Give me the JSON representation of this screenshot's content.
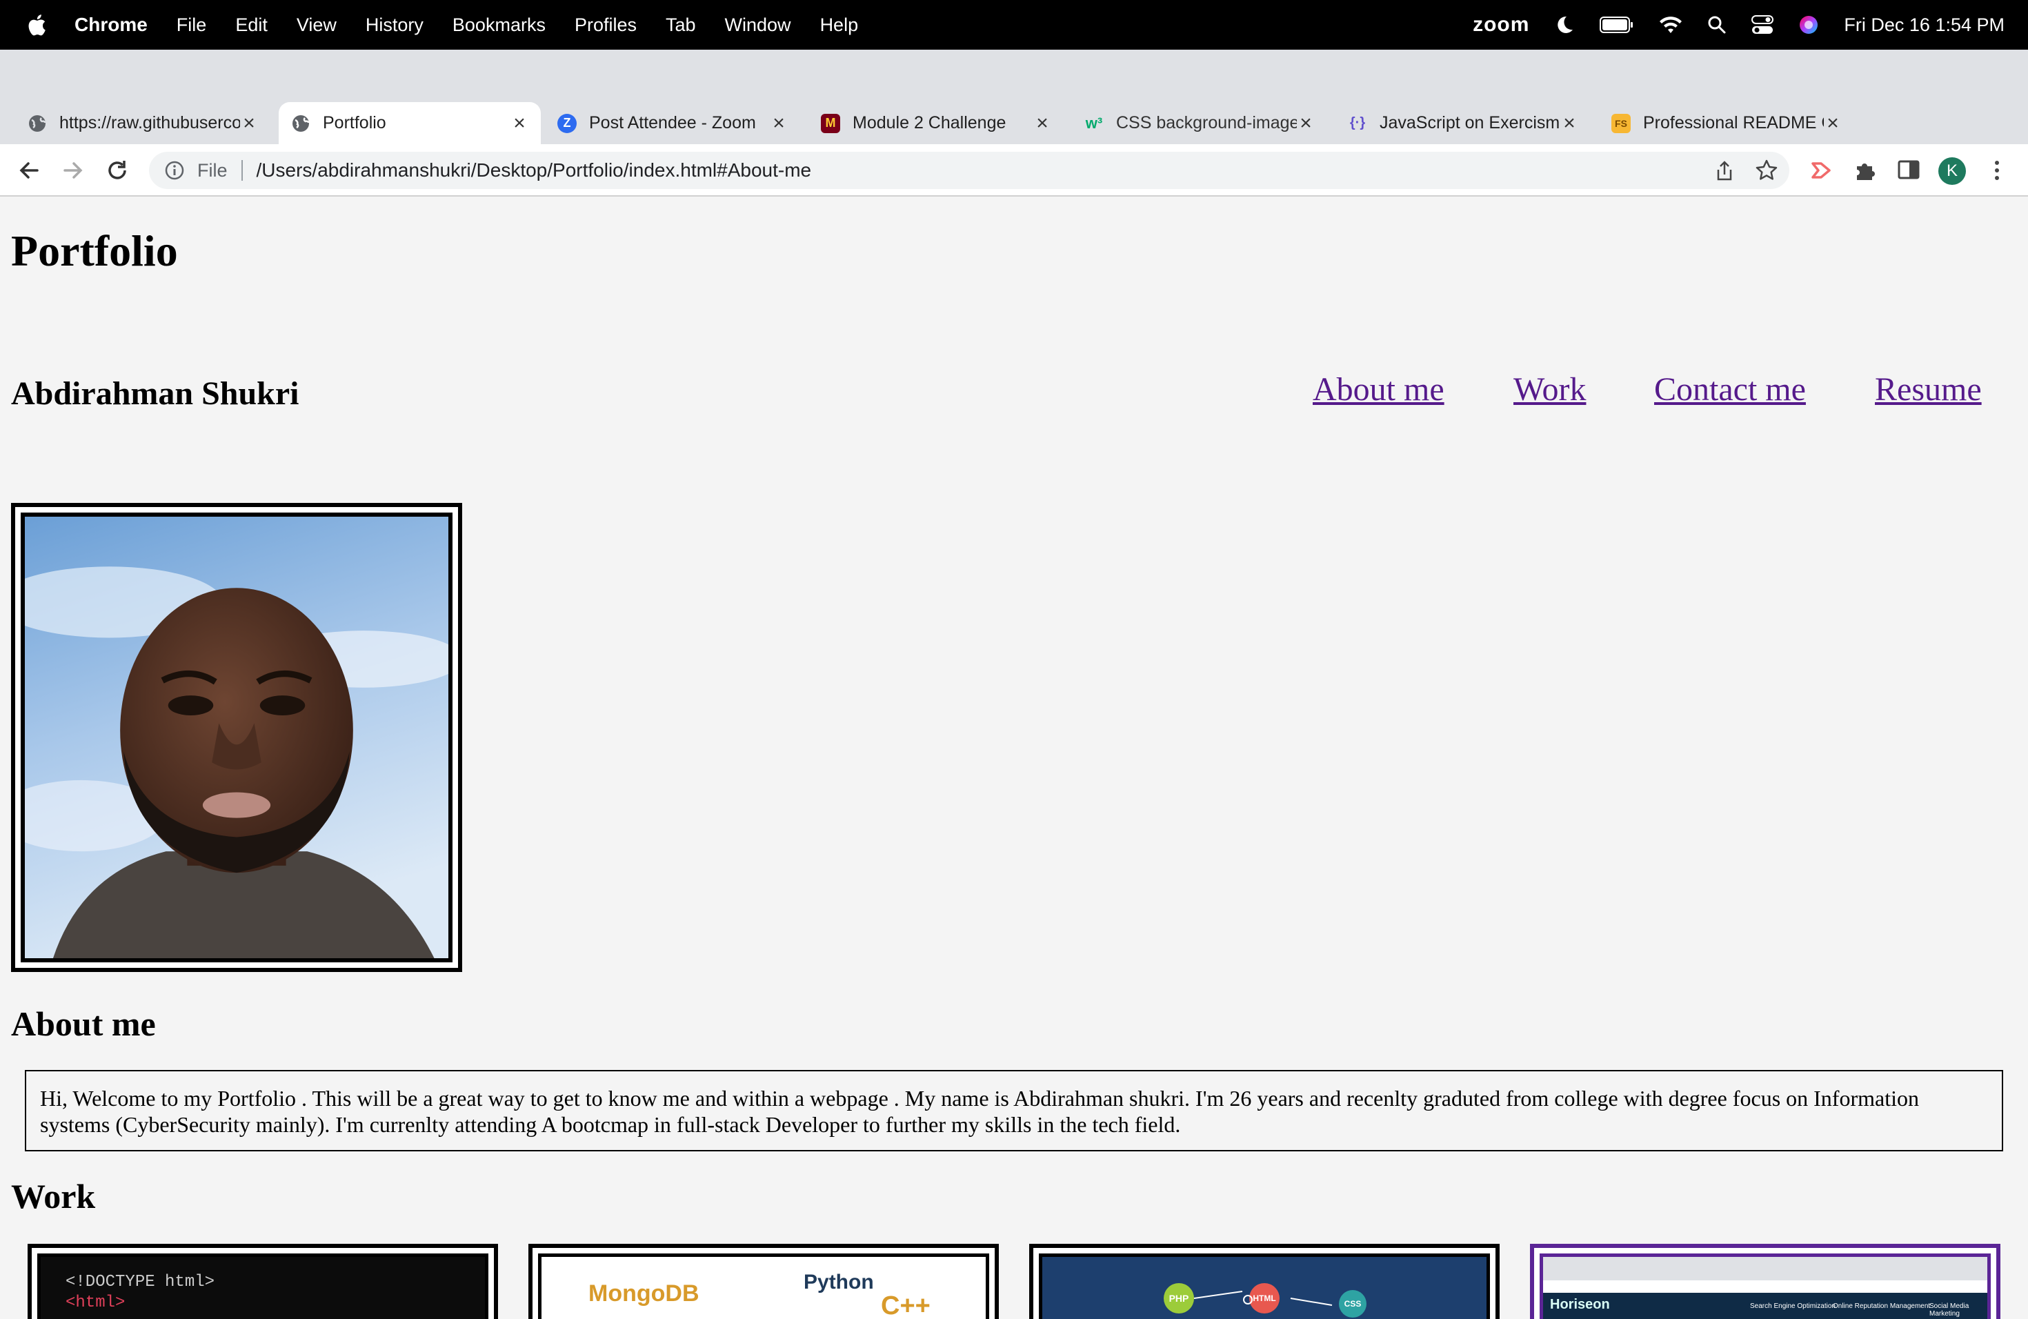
{
  "menubar": {
    "items": [
      "Chrome",
      "File",
      "Edit",
      "View",
      "History",
      "Bookmarks",
      "Profiles",
      "Tab",
      "Window",
      "Help"
    ],
    "zoom_label": "zoom",
    "datetime": "Fri Dec 16  1:54 PM"
  },
  "tabs": [
    {
      "title": "https://raw.githubusercontent",
      "icon": "globe-icon"
    },
    {
      "title": "Portfolio",
      "icon": "globe-icon",
      "active": true
    },
    {
      "title": "Post Attendee - Zoom",
      "icon": "zoom-icon"
    },
    {
      "title": "Module 2 Challenge",
      "icon": "canvas-icon"
    },
    {
      "title": "CSS background-image",
      "icon": "w3schools-icon"
    },
    {
      "title": "JavaScript on Exercism",
      "icon": "exercism-icon"
    },
    {
      "title": "Professional README Guide",
      "icon": "fs-icon"
    }
  ],
  "address_bar": {
    "scheme": "File",
    "url": "/Users/abdirahmanshukri/Desktop/Portfolio/index.html#About-me"
  },
  "profile_initial": "K",
  "page": {
    "site_title": "Portfolio",
    "owner_name": "Abdirahman Shukri",
    "nav": [
      "About me",
      "Work",
      "Contact me",
      "Resume"
    ],
    "about_heading": "About me",
    "about_text": "Hi, Welcome to my Portfolio . This will be a great way to get to know me and within a webpage . My name is Abdirahman shukri. I'm 26 years and recenlty graduted from college with degree focus on Information systems (CyberSecurity mainly). I'm currenlty attending A bootcmap in full-stack Developer to further my skills in the tech field.",
    "work_heading": "Work",
    "work_cards": [
      {
        "code_lines": [
          "<!DOCTYPE html>",
          "<html>"
        ]
      },
      {
        "words": [
          "MongoDB",
          "Python",
          "C++"
        ]
      },
      {
        "badges": [
          "PHP",
          "HTML",
          "CSS"
        ]
      },
      {
        "site_name": "Horiseon",
        "nav": [
          "Search Engine Optimization",
          "Online Reputation Management",
          "Social Media Marketing"
        ]
      }
    ]
  },
  "colors": {
    "link": "#551a8b",
    "work_card_4_border": "#5b2596"
  }
}
